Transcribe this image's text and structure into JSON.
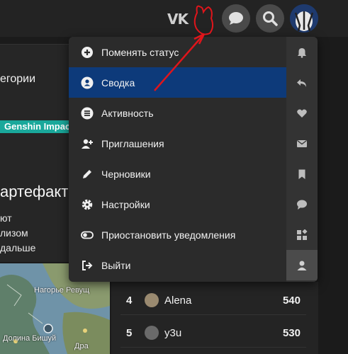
{
  "topbar": {
    "vk_label": "VK",
    "icons": [
      "vk-icon",
      "chat-icon",
      "search-icon",
      "avatar"
    ]
  },
  "left": {
    "category_label": "егории",
    "tag": "Genshin Impact",
    "article_title": "артефакты",
    "lines": [
      "ют",
      "лизом",
      "дальше"
    ]
  },
  "map": {
    "labels": [
      "Нагорье Ревущ",
      "Долина Бишуй",
      "Дра"
    ]
  },
  "menu": {
    "items": [
      {
        "label": "Поменять статус",
        "icon": "plus-circle-icon"
      },
      {
        "label": "Сводка",
        "icon": "user-icon",
        "active": true
      },
      {
        "label": "Активность",
        "icon": "list-icon"
      },
      {
        "label": "Приглашения",
        "icon": "add-user-icon"
      },
      {
        "label": "Черновики",
        "icon": "pencil-icon"
      },
      {
        "label": "Настройки",
        "icon": "gear-icon"
      },
      {
        "label": "Приостановить уведомления",
        "icon": "toggle-icon"
      },
      {
        "label": "Выйти",
        "icon": "logout-icon"
      }
    ],
    "side_icons": [
      "bell-icon",
      "reply-icon",
      "heart-icon",
      "mail-icon",
      "bookmark-icon",
      "comment-icon",
      "widgets-icon",
      "user-icon"
    ]
  },
  "leaderboard": [
    {
      "rank": "4",
      "name": "Alena",
      "score": "540"
    },
    {
      "rank": "5",
      "name": "y3u",
      "score": "530"
    }
  ],
  "colors": {
    "active_bg": "#0d3a7a",
    "tag_bg": "#1aa89b",
    "annotation": "#e0151b"
  }
}
